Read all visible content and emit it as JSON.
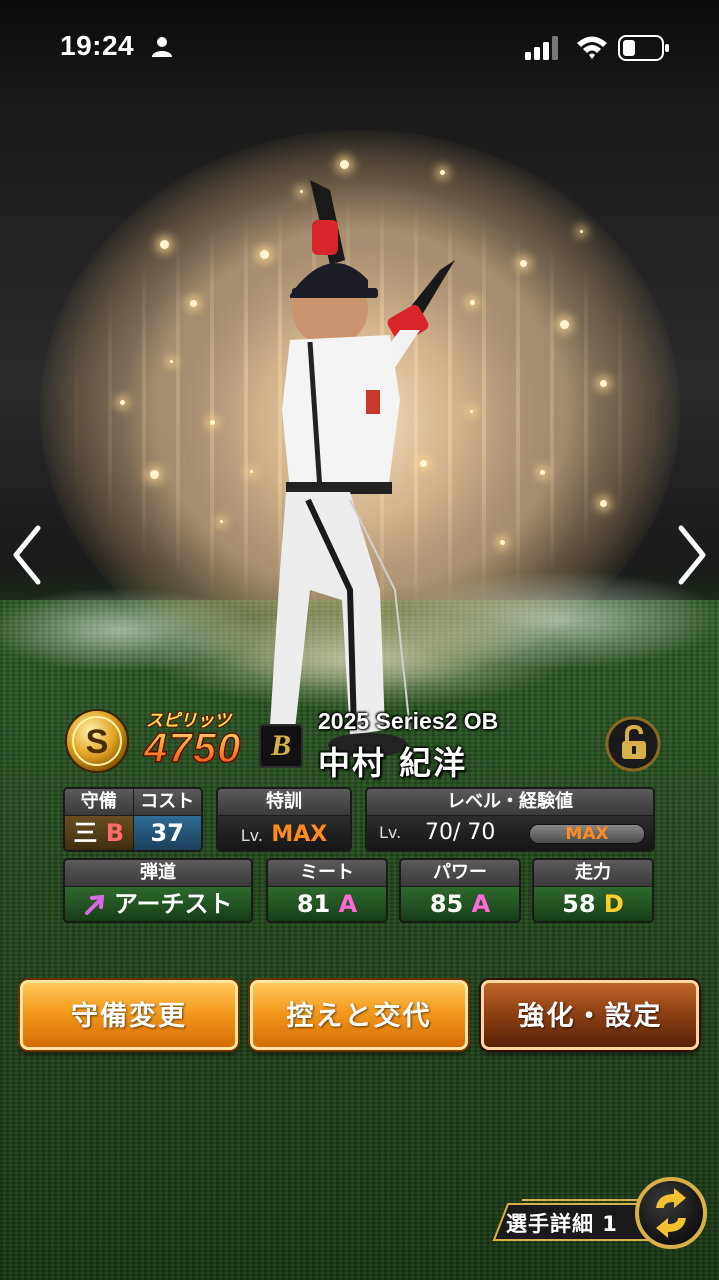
{
  "status_bar": {
    "time": "19:24",
    "icons": [
      "person-icon",
      "signal-icon",
      "wifi-icon",
      "battery-icon"
    ]
  },
  "player_card": {
    "rarity": "S",
    "spirits_label": "スピリッツ",
    "spirits_value": "4750",
    "team_logo": "B",
    "series": "2025 Series2 OB",
    "name": "中村 紀洋",
    "lock_icon": "lock-open-icon"
  },
  "stats": {
    "position": {
      "header": "守備",
      "value": "三",
      "grade": "B"
    },
    "cost": {
      "header": "コスト",
      "value": "37"
    },
    "training": {
      "header": "特訓",
      "lv_label": "Lv.",
      "value": "MAX"
    },
    "level": {
      "header": "レベル・経験値",
      "lv_label": "Lv.",
      "value": "70/ 70",
      "bar_label": "MAX",
      "bar_fill": 1.0
    },
    "trajectory": {
      "header": "弾道",
      "value": "アーチスト",
      "icon": "arrow-up-right-icon"
    },
    "meet": {
      "header": "ミート",
      "value": "81",
      "grade": "A"
    },
    "power": {
      "header": "パワー",
      "value": "85",
      "grade": "A"
    },
    "speed": {
      "header": "走力",
      "value": "58",
      "grade": "D"
    }
  },
  "actions": {
    "defense_change": "守備変更",
    "bench_swap": "控えと交代",
    "enhance_settings": "強化・設定"
  },
  "footer": {
    "detail_tab": "選手詳細 1",
    "swap_icon": "swap-arrows-icon"
  },
  "colors": {
    "accent_orange": "#f49a1c",
    "grade_A": "#ff6ad8",
    "grade_B": "#ff6a6a",
    "grade_D": "#ffd02a",
    "max_orange": "#ff8a1f"
  }
}
